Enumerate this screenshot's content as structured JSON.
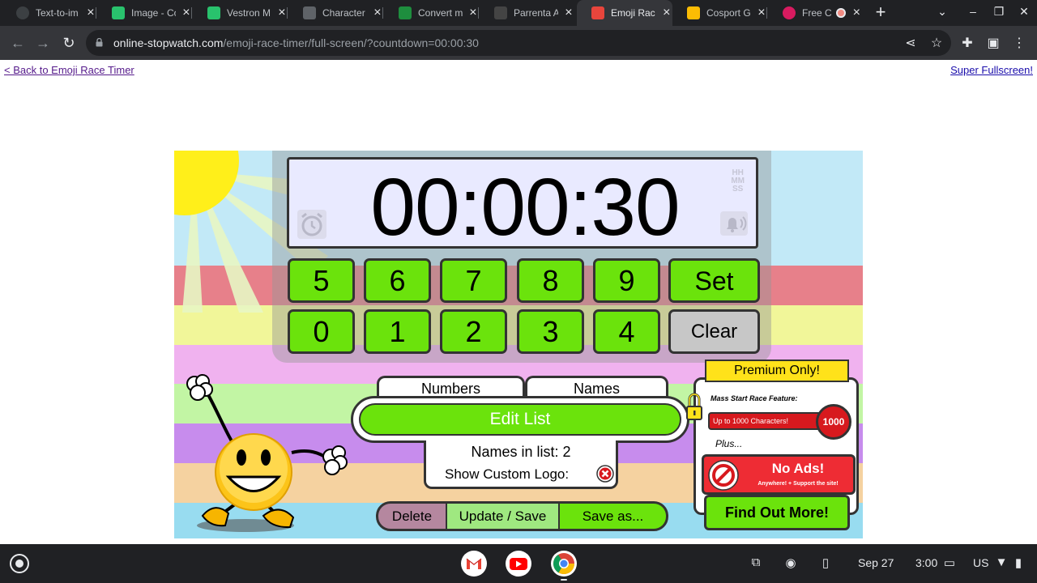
{
  "browser": {
    "tabs": [
      {
        "title": "Text-to-im",
        "favicon_color": "#3c4043"
      },
      {
        "title": "Image - Co",
        "favicon_color": "#29c26d"
      },
      {
        "title": "Vestron M",
        "favicon_color": "#29c26d"
      },
      {
        "title": "Character",
        "favicon_color": "#5f6368"
      },
      {
        "title": "Convert m",
        "favicon_color": "#1e8e3e"
      },
      {
        "title": "Parrenta A",
        "favicon_color": "#444444"
      },
      {
        "title": "Emoji Rac",
        "favicon_color": "#e8453c",
        "active": true
      },
      {
        "title": "Cosport G",
        "favicon_color": "#fbbc04"
      },
      {
        "title": "Free C",
        "favicon_color": "#d81b60"
      }
    ],
    "url_domain": "online-stopwatch.com",
    "url_path": "/emoji-race-timer/full-screen/?countdown=00:00:30"
  },
  "page": {
    "back_link": "< Back to Emoji Race Timer",
    "fullscreen_link": "Super Fullscreen!"
  },
  "timer": {
    "display": "00:00:30",
    "format_hh": "HH",
    "format_mm": "MM",
    "format_ss": "SS",
    "keys_row1": [
      "5",
      "6",
      "7",
      "8",
      "9"
    ],
    "keys_row2": [
      "0",
      "1",
      "2",
      "3",
      "4"
    ],
    "set_label": "Set",
    "clear_label": "Clear"
  },
  "list_panel": {
    "tab_numbers": "Numbers",
    "tab_names": "Names",
    "edit_label": "Edit List",
    "names_in_list": "Names in list: 2",
    "custom_logo": "Show Custom Logo:"
  },
  "actions": {
    "delete": "Delete",
    "update": "Update / Save",
    "save_as": "Save as..."
  },
  "premium": {
    "title": "Premium Only!",
    "mass_start": "Mass Start Race Feature:",
    "chars_text": "Up to 1000 Characters!",
    "chars_number": "1000",
    "plus": "Plus...",
    "no_ads": "No Ads!",
    "no_ads_sub": "Anywhere! + Support the site!",
    "find_out": "Find Out More!"
  },
  "shelf": {
    "date": "Sep 27",
    "time": "3:00",
    "locale": "US"
  },
  "colors": {
    "key_green": "#6be30c",
    "clear_gray": "#c7c7c7",
    "premium_yellow": "#ffe21a",
    "premium_red": "#d7191e",
    "stripe_red": "#e7808a",
    "stripe_yellow": "#f1f699",
    "stripe_pink": "#f0b2ef",
    "stripe_green": "#c2f5a4",
    "stripe_purple": "#c78ced",
    "stripe_peach": "#f5d2a0",
    "stripe_blue": "#98dcf0"
  }
}
